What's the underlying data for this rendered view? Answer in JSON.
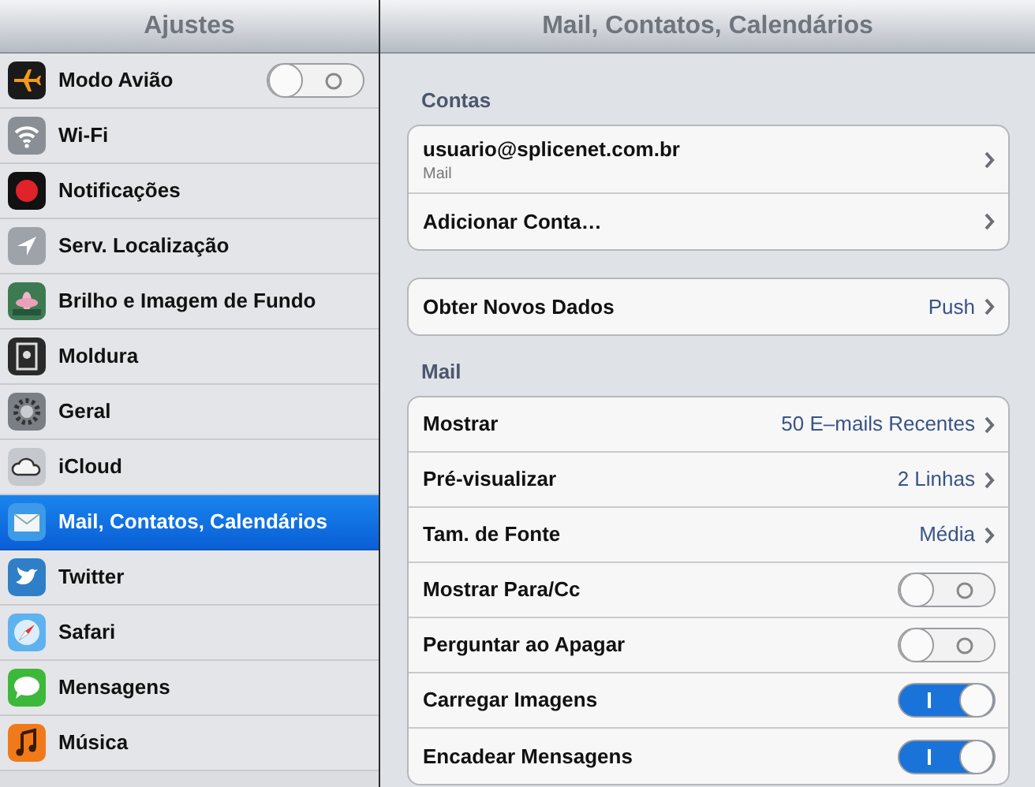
{
  "sidebar": {
    "title": "Ajustes",
    "items": [
      {
        "label": "Modo Avião",
        "selected": false,
        "kind": "toggle",
        "on": false
      },
      {
        "label": "Wi-Fi",
        "selected": false,
        "kind": "link"
      },
      {
        "label": "Notificações",
        "selected": false,
        "kind": "link"
      },
      {
        "label": "Serv. Localização",
        "selected": false,
        "kind": "link"
      },
      {
        "label": "Brilho e Imagem de Fundo",
        "selected": false,
        "kind": "link"
      },
      {
        "label": "Moldura",
        "selected": false,
        "kind": "link"
      },
      {
        "label": "Geral",
        "selected": false,
        "kind": "link"
      },
      {
        "label": "iCloud",
        "selected": false,
        "kind": "link"
      },
      {
        "label": "Mail, Contatos, Calendários",
        "selected": true,
        "kind": "link"
      },
      {
        "label": "Twitter",
        "selected": false,
        "kind": "link"
      },
      {
        "label": "Safari",
        "selected": false,
        "kind": "link"
      },
      {
        "label": "Mensagens",
        "selected": false,
        "kind": "link"
      },
      {
        "label": "Música",
        "selected": false,
        "kind": "link"
      }
    ]
  },
  "detail": {
    "title": "Mail, Contatos, Calendários",
    "sections": [
      {
        "header": "Contas",
        "rows": [
          {
            "kind": "account",
            "label": "usuario@splicenet.com.br",
            "subtitle": "Mail"
          },
          {
            "kind": "link",
            "label": "Adicionar Conta…"
          }
        ]
      },
      {
        "rows": [
          {
            "kind": "link",
            "label": "Obter Novos Dados",
            "value": "Push"
          }
        ]
      },
      {
        "header": "Mail",
        "rows": [
          {
            "kind": "link",
            "label": "Mostrar",
            "value": "50 E–mails Recentes"
          },
          {
            "kind": "link",
            "label": "Pré-visualizar",
            "value": "2 Linhas"
          },
          {
            "kind": "link",
            "label": "Tam. de Fonte",
            "value": "Média"
          },
          {
            "kind": "toggle",
            "label": "Mostrar Para/Cc",
            "on": false
          },
          {
            "kind": "toggle",
            "label": "Perguntar ao Apagar",
            "on": false
          },
          {
            "kind": "toggle",
            "label": "Carregar Imagens",
            "on": true
          },
          {
            "kind": "toggle",
            "label": "Encadear Mensagens",
            "on": true
          }
        ]
      }
    ]
  }
}
